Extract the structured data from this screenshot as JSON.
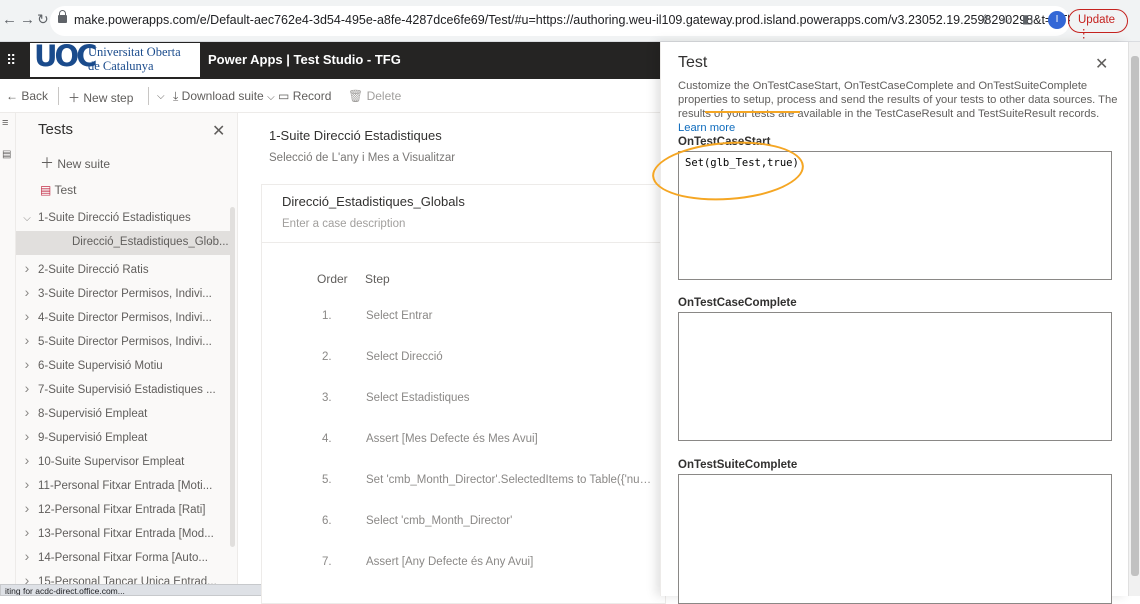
{
  "browser": {
    "url": "make.powerapps.com/e/Default-aec762e4-3d54-495e-a8fe-4287dce6fe69/Test/#u=https://authoring.weu-il109.gateway.prod.island.powerapps.com/v3.23052.19.2598290298&t=ATk4Kgdq...",
    "profile_initial": "I",
    "update_label": "Update"
  },
  "logo": {
    "mark": "UOC",
    "line1": "Universitat Oberta",
    "line2": "de Catalunya"
  },
  "app": {
    "title": "Power Apps | Test Studio - TFG"
  },
  "command_bar": {
    "back": "Back",
    "new_step": "New step",
    "download_suite": "Download suite",
    "record": "Record",
    "delete": "Delete"
  },
  "tree": {
    "title": "Tests",
    "new_suite": "New suite",
    "test_item": "Test",
    "items": [
      {
        "label": "1-Suite Direcció Estadistiques",
        "expanded": true
      },
      {
        "label": "Direcció_Estadistiques_Glob...",
        "child": true,
        "selected": true
      },
      {
        "label": "2-Suite Direcció Ratis"
      },
      {
        "label": "3-Suite Director Permisos, Indivi..."
      },
      {
        "label": "4-Suite Director Permisos, Indivi..."
      },
      {
        "label": "5-Suite Director Permisos, Indivi..."
      },
      {
        "label": "6-Suite Supervisió Motiu"
      },
      {
        "label": "7-Suite Supervisió Estadistiques ..."
      },
      {
        "label": "8-Supervisió Empleat"
      },
      {
        "label": "9-Supervisió Empleat"
      },
      {
        "label": "10-Suite Supervisor Empleat"
      },
      {
        "label": "11-Personal Fitxar Entrada [Moti..."
      },
      {
        "label": "12-Personal Fitxar Entrada [Rati]"
      },
      {
        "label": "13-Personal Fitxar Entrada [Mod..."
      },
      {
        "label": "14-Personal Fitxar Forma [Auto..."
      },
      {
        "label": "15-Personal Tancar Unica Entrad..."
      }
    ]
  },
  "status_text": "iting for acdc-direct.office.com...",
  "suite": {
    "title": "1-Suite Direcció Estadistiques",
    "description": "Selecció de L'any i Mes a Visualitzar"
  },
  "test_case": {
    "title": "Direcció_Estadistiques_Globals",
    "description_placeholder": "Enter a case description",
    "col_order": "Order",
    "col_step": "Step",
    "steps": [
      {
        "order": "1.",
        "step": "Select Entrar"
      },
      {
        "order": "2.",
        "step": "Select Direcció"
      },
      {
        "order": "3.",
        "step": "Select Estadistiques"
      },
      {
        "order": "4.",
        "step": "Assert [Mes Defecte és Mes Avui]"
      },
      {
        "order": "5.",
        "step": "Set 'cmb_Month_Director'.SelectedItems to Table({'number'..."
      },
      {
        "order": "6.",
        "step": "Select 'cmb_Month_Director'"
      },
      {
        "order": "7.",
        "step": "Assert [Any Defecte és Any Avui]"
      }
    ]
  },
  "panel": {
    "title": "Test",
    "description": "Customize the OnTestCaseStart, OnTestCaseComplete and OnTestSuiteComplete properties to setup, process and send the results of your tests to other data sources. The results of your tests are available in the TestCaseResult and TestSuiteResult records.",
    "learn_more": "Learn more",
    "on_case_start_label": "OnTestCaseStart",
    "on_case_start_value": "Set(glb_Test,true)",
    "on_case_complete_label": "OnTestCaseComplete",
    "on_case_complete_value": "",
    "on_suite_complete_label": "OnTestSuiteComplete",
    "on_suite_complete_value": ""
  },
  "colors": {
    "annotation": "#f5a623",
    "link": "#0f6cbd",
    "app_header": "#252423"
  }
}
